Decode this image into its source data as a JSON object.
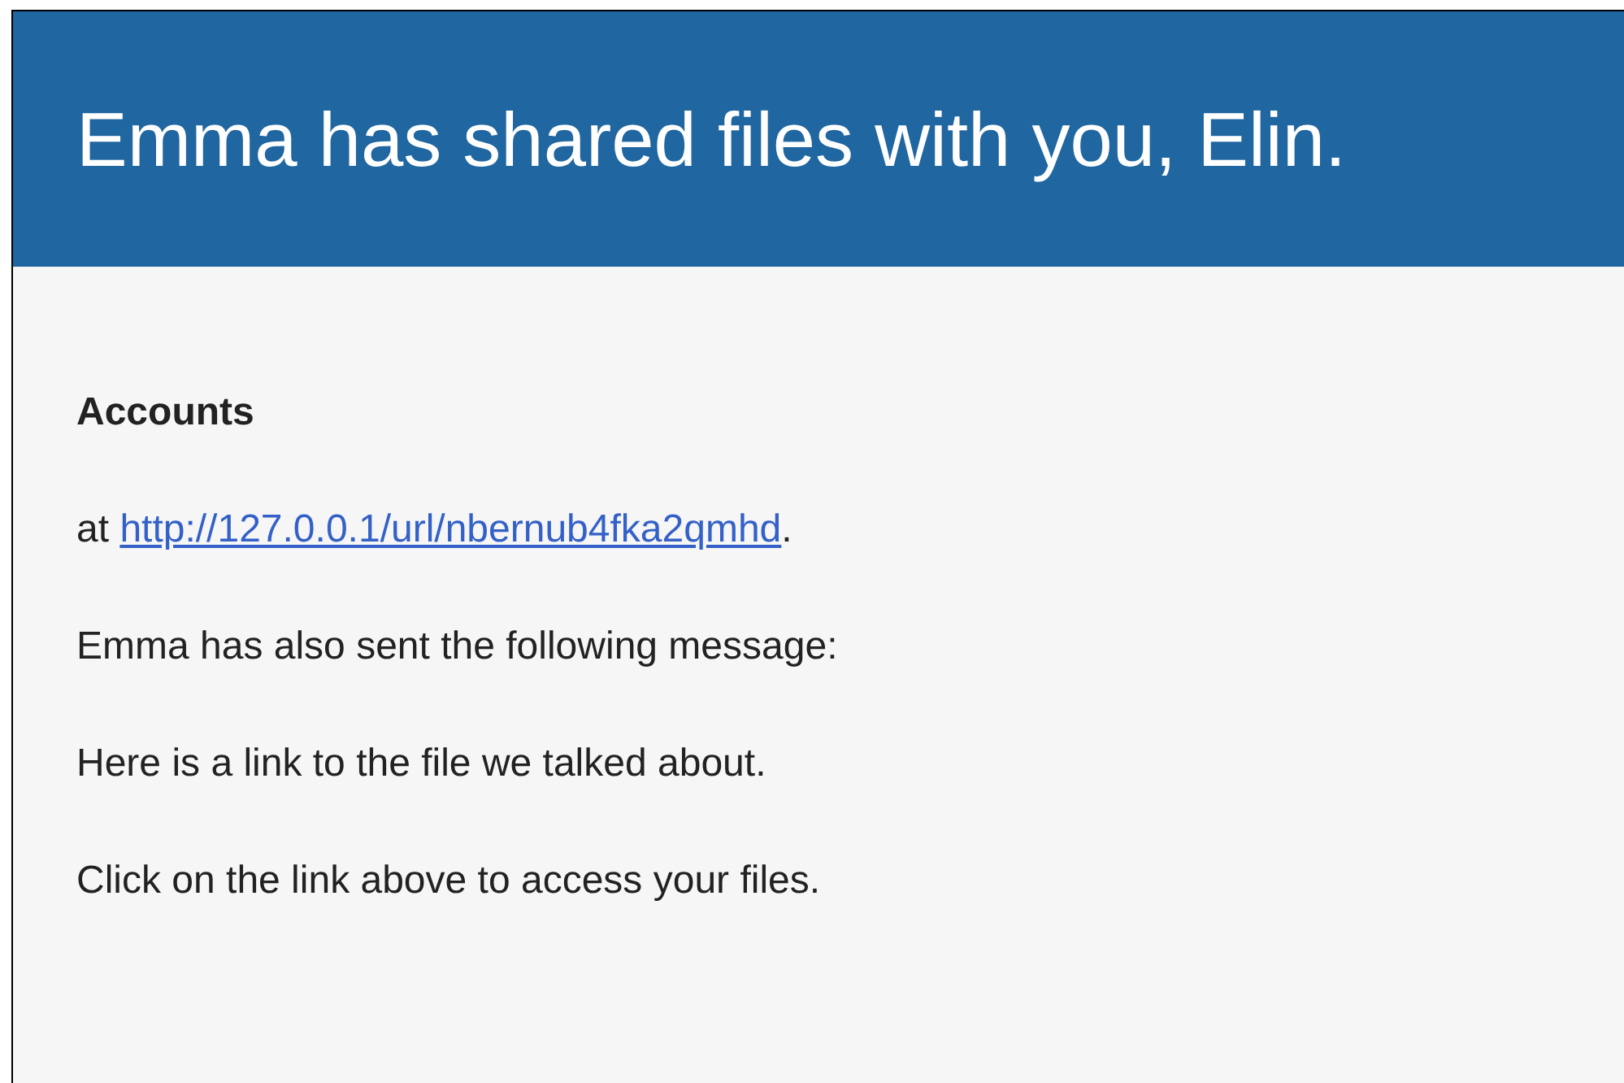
{
  "header": {
    "title": "Emma has shared files with you, Elin."
  },
  "body": {
    "heading": "Accounts",
    "link_line": {
      "prefix": "at ",
      "url": "http://127.0.0.1/url/nbernub4fka2qmhd",
      "suffix": "."
    },
    "paragraphs": [
      "Emma has also sent the following message:",
      "Here is a link to the file we talked about.",
      "Click on the link above to access your files."
    ]
  }
}
